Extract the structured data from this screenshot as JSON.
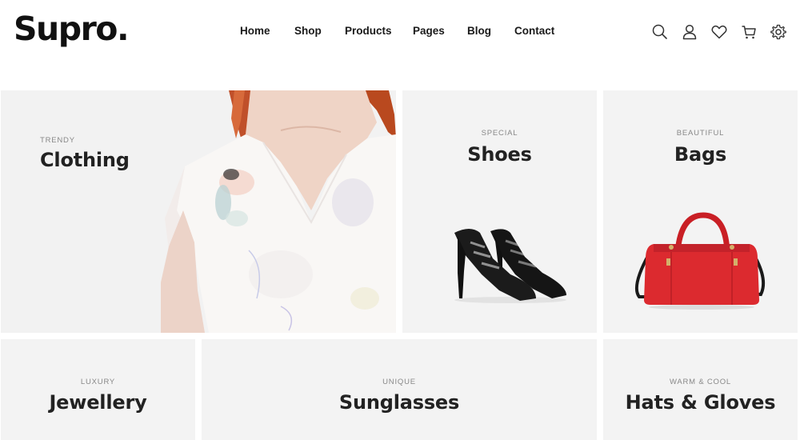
{
  "brand": {
    "logo": "Supro."
  },
  "nav": {
    "items": [
      "Home",
      "Shop",
      "Products",
      "Pages",
      "Blog",
      "Contact"
    ]
  },
  "header_icons": [
    "search-icon",
    "user-icon",
    "heart-icon",
    "cart-icon",
    "gear-icon"
  ],
  "categories": [
    {
      "kicker": "TRENDY",
      "title": "Clothing"
    },
    {
      "kicker": "SPECIAL",
      "title": "Shoes"
    },
    {
      "kicker": "BEAUTIFUL",
      "title": "Bags"
    },
    {
      "kicker": "LUXURY",
      "title": "Jewellery"
    },
    {
      "kicker": "UNIQUE",
      "title": "Sunglasses"
    },
    {
      "kicker": "WARM & COOL",
      "title": "Hats & Gloves"
    }
  ],
  "colors": {
    "tile_bg": "#f3f3f3",
    "bag_red": "#d8262c",
    "text_dark": "#222222",
    "kicker_gray": "#888888"
  }
}
